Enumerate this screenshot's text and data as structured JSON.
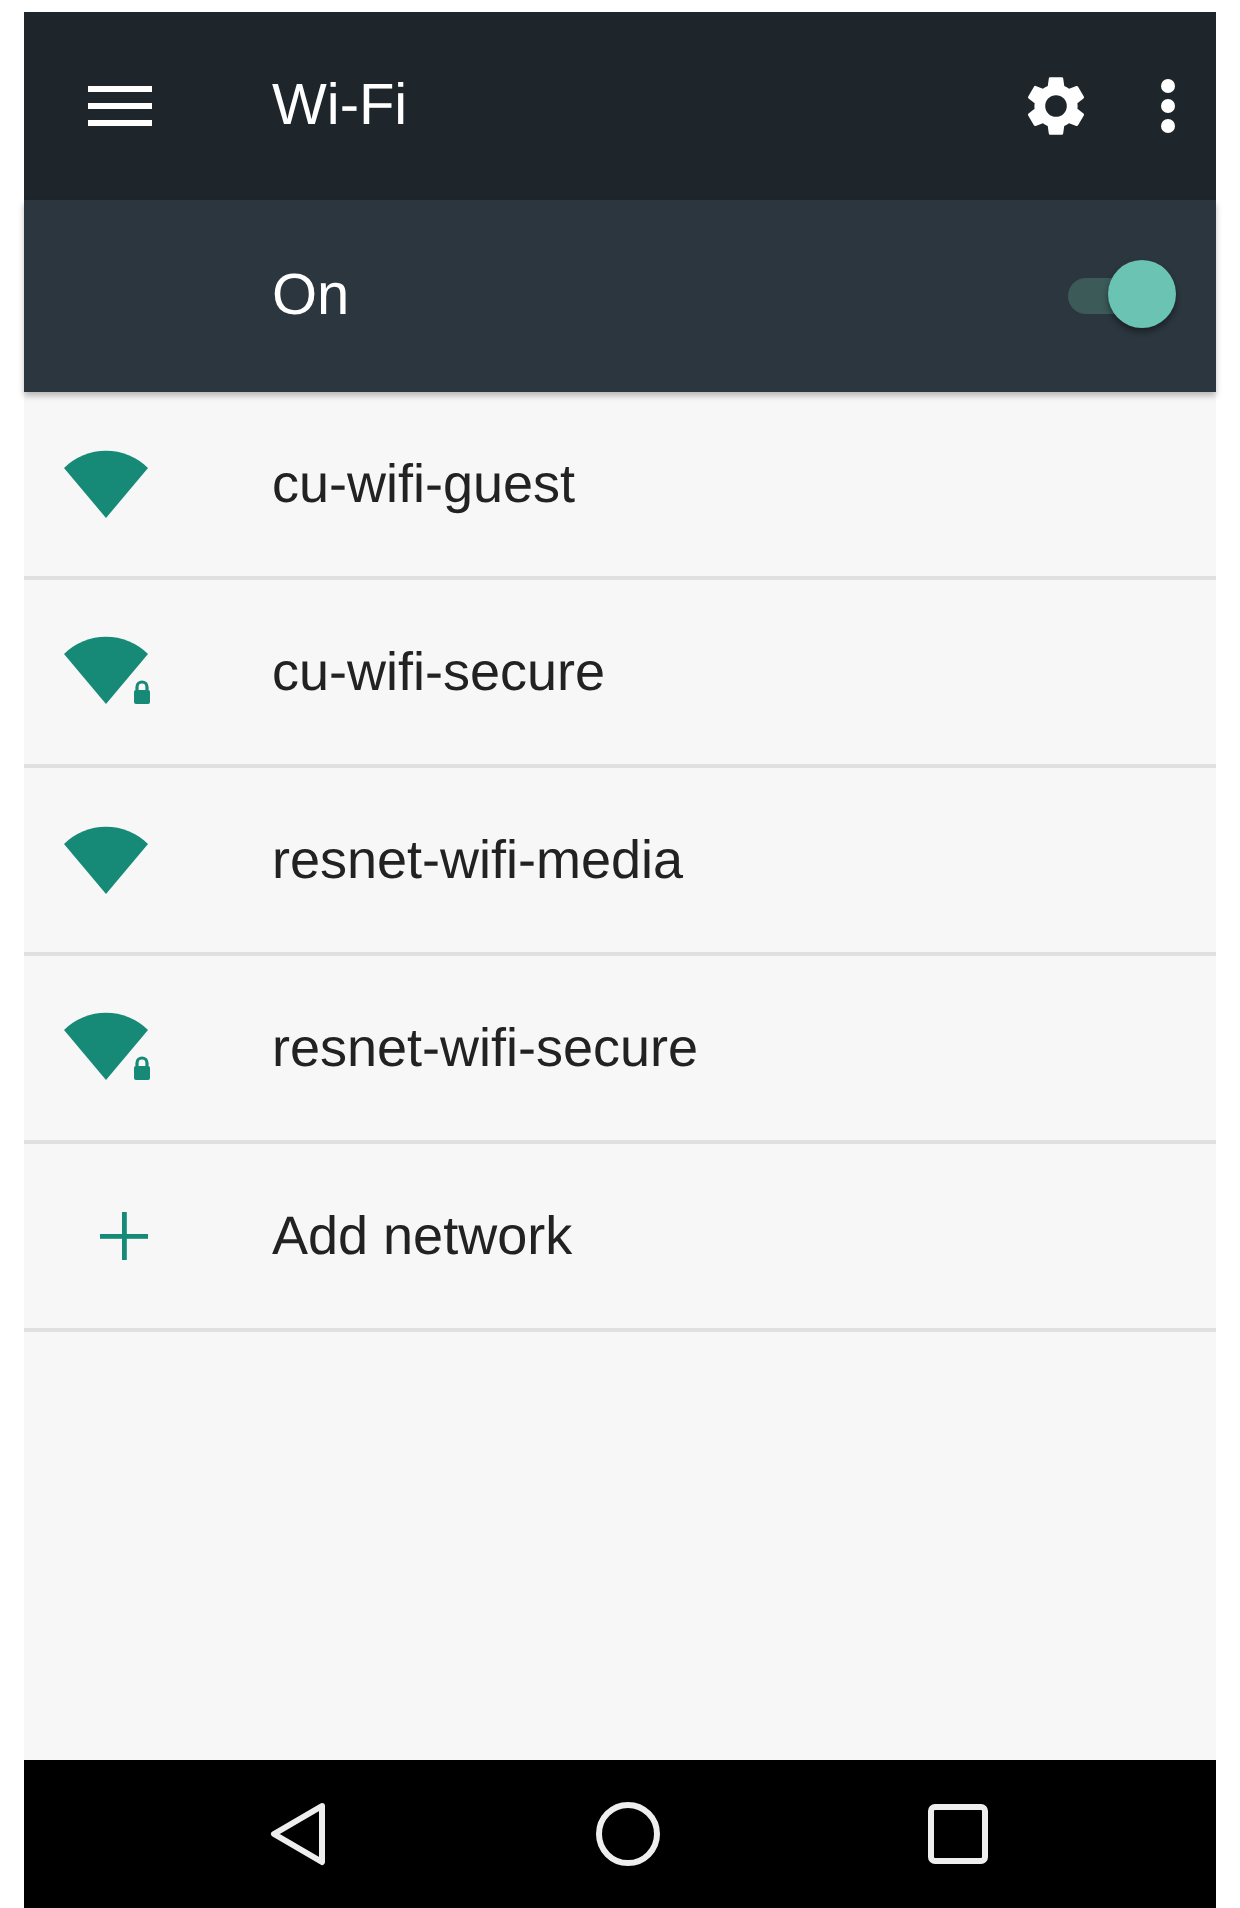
{
  "app_bar": {
    "title": "Wi-Fi"
  },
  "master_switch": {
    "label": "On",
    "on": true
  },
  "networks": [
    {
      "kind": "network",
      "name": "cu-wifi-guest",
      "locked": false
    },
    {
      "kind": "network",
      "name": "cu-wifi-secure",
      "locked": true
    },
    {
      "kind": "network",
      "name": "resnet-wifi-media",
      "locked": false
    },
    {
      "kind": "network",
      "name": "resnet-wifi-secure",
      "locked": true
    },
    {
      "kind": "add",
      "name": "Add network"
    }
  ]
}
